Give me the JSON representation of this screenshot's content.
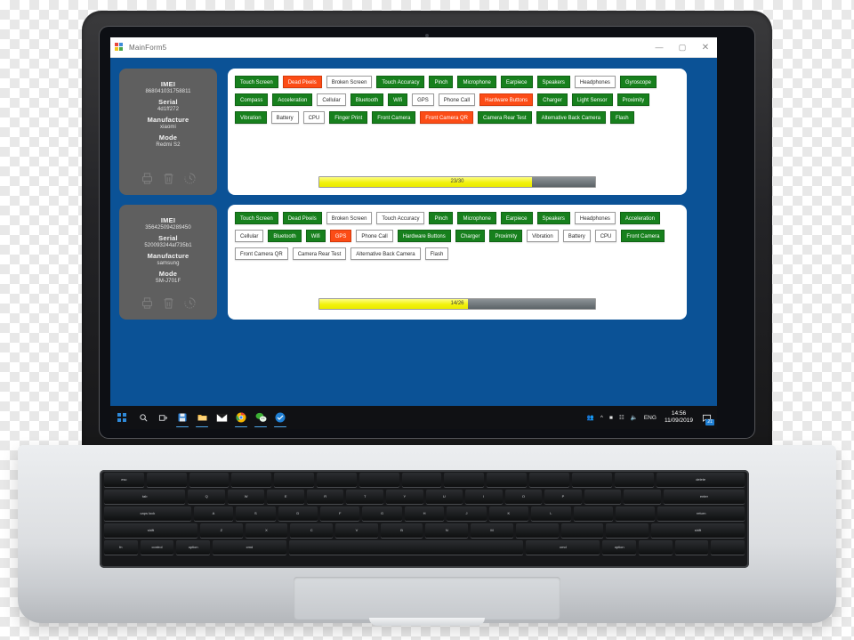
{
  "window": {
    "title": "MainForm5",
    "icon": "app-icon",
    "minimize_label": "—",
    "maximize_label": "▢",
    "close_label": "✕"
  },
  "labels": {
    "imei": "IMEI",
    "serial": "Serial",
    "manufacture": "Manufacture",
    "mode": "Mode"
  },
  "device_actions": [
    {
      "name": "print-icon",
      "label": "Print"
    },
    {
      "name": "delete-icon",
      "label": "Delete"
    },
    {
      "name": "history-icon",
      "label": "History"
    }
  ],
  "panels": [
    {
      "id": "panel-1",
      "device": {
        "imei": "868041031758811",
        "serial": "4d1ff272",
        "manufacture": "xiaomi",
        "mode": "Redmi S2"
      },
      "progress": {
        "text": "23/30",
        "value": 23,
        "max": 30,
        "percent": 77
      },
      "tests": [
        {
          "label": "Touch Screen",
          "status": "pass"
        },
        {
          "label": "Dead Pixels",
          "status": "fail"
        },
        {
          "label": "Broken Screen",
          "status": "none"
        },
        {
          "label": "Touch Accuracy",
          "status": "pass"
        },
        {
          "label": "Pinch",
          "status": "pass"
        },
        {
          "label": "Microphone",
          "status": "pass"
        },
        {
          "label": "Earpiece",
          "status": "pass"
        },
        {
          "label": "Speakers",
          "status": "pass"
        },
        {
          "label": "Headphones",
          "status": "none"
        },
        {
          "label": "Gyroscope",
          "status": "pass"
        },
        {
          "label": "Compass",
          "status": "pass"
        },
        {
          "label": "Acceleration",
          "status": "pass"
        },
        {
          "label": "Cellular",
          "status": "none"
        },
        {
          "label": "Bluetooth",
          "status": "pass"
        },
        {
          "label": "Wifi",
          "status": "pass"
        },
        {
          "label": "GPS",
          "status": "none"
        },
        {
          "label": "Phone Call",
          "status": "none"
        },
        {
          "label": "Hardware Buttons",
          "status": "fail"
        },
        {
          "label": "Charger",
          "status": "pass"
        },
        {
          "label": "Light Sensor",
          "status": "pass"
        },
        {
          "label": "Proximity",
          "status": "pass"
        },
        {
          "label": "Vibration",
          "status": "pass"
        },
        {
          "label": "Battery",
          "status": "none"
        },
        {
          "label": "CPU",
          "status": "none"
        },
        {
          "label": "Finger Print",
          "status": "pass"
        },
        {
          "label": "Front Camera",
          "status": "pass"
        },
        {
          "label": "Front Camera QR",
          "status": "fail"
        },
        {
          "label": "Camera Rear Test",
          "status": "pass"
        },
        {
          "label": "Alternative Back Camera",
          "status": "pass"
        },
        {
          "label": "Flash",
          "status": "pass"
        }
      ]
    },
    {
      "id": "panel-2",
      "device": {
        "imei": "356425094289450",
        "serial": "520093244af735b1",
        "manufacture": "samsung",
        "mode": "SM-J701F"
      },
      "progress": {
        "text": "14/26",
        "value": 14,
        "max": 26,
        "percent": 54
      },
      "tests": [
        {
          "label": "Touch Screen",
          "status": "pass"
        },
        {
          "label": "Dead Pixels",
          "status": "pass"
        },
        {
          "label": "Broken Screen",
          "status": "none"
        },
        {
          "label": "Touch Accuracy",
          "status": "none"
        },
        {
          "label": "Pinch",
          "status": "pass"
        },
        {
          "label": "Microphone",
          "status": "pass"
        },
        {
          "label": "Earpiece",
          "status": "pass"
        },
        {
          "label": "Speakers",
          "status": "pass"
        },
        {
          "label": "Headphones",
          "status": "none"
        },
        {
          "label": "Acceleration",
          "status": "pass"
        },
        {
          "label": "Cellular",
          "status": "none"
        },
        {
          "label": "Bluetooth",
          "status": "pass"
        },
        {
          "label": "Wifi",
          "status": "pass"
        },
        {
          "label": "GPS",
          "status": "fail"
        },
        {
          "label": "Phone Call",
          "status": "none"
        },
        {
          "label": "Hardware Buttons",
          "status": "pass"
        },
        {
          "label": "Charger",
          "status": "pass"
        },
        {
          "label": "Proximity",
          "status": "pass"
        },
        {
          "label": "Vibration",
          "status": "none"
        },
        {
          "label": "Battery",
          "status": "none"
        },
        {
          "label": "CPU",
          "status": "none"
        },
        {
          "label": "Front Camera",
          "status": "pass"
        },
        {
          "label": "Front Camera QR",
          "status": "none"
        },
        {
          "label": "Camera Rear Test",
          "status": "none"
        },
        {
          "label": "Alternative Back Camera",
          "status": "none"
        },
        {
          "label": "Flash",
          "status": "none"
        }
      ]
    }
  ],
  "scrollbar": {
    "left_arrow": "‹",
    "right_arrow": "›"
  },
  "taskbar": {
    "start": "start-button",
    "items": [
      {
        "name": "search-icon",
        "active": false
      },
      {
        "name": "task-view-icon",
        "active": false
      },
      {
        "name": "save-app-icon",
        "active": true
      },
      {
        "name": "file-explorer-icon",
        "active": true
      },
      {
        "name": "mail-icon",
        "active": false
      },
      {
        "name": "chrome-icon",
        "active": true
      },
      {
        "name": "wechat-icon",
        "active": true
      },
      {
        "name": "app-blue-icon",
        "active": true
      }
    ],
    "tray": {
      "language": "ENG",
      "time": "14:56",
      "date": "11/09/2019",
      "notification_count": "21"
    }
  },
  "colors": {
    "desktop": "#0b5296",
    "pass": "#17801d",
    "fail": "#fc4c16",
    "neutral": "#ffffff",
    "info_panel": "#5f5f5f",
    "progress_fill": "#f2f20c"
  }
}
